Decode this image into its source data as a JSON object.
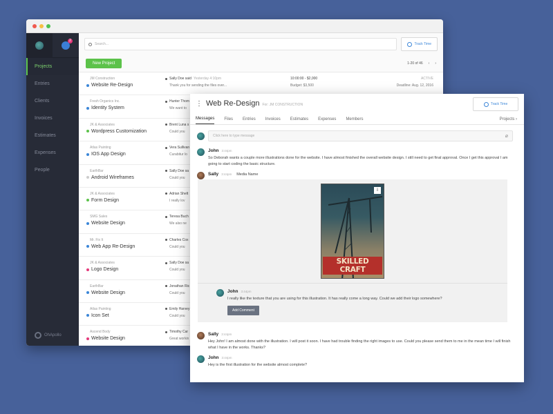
{
  "back_window": {
    "sidebar": {
      "notification_count": "2",
      "items": [
        {
          "label": "Projects",
          "active": true
        },
        {
          "label": "Entries"
        },
        {
          "label": "Clients"
        },
        {
          "label": "Invoices"
        },
        {
          "label": "Estimates"
        },
        {
          "label": "Expenses"
        },
        {
          "label": "People"
        }
      ],
      "footer": "OhApollo"
    },
    "search": {
      "placeholder": "Search..."
    },
    "track_time_label": "Track Time",
    "new_project_label": "New Project",
    "pagination": "1-20 of 46",
    "rows": [
      {
        "client": "JM Construction",
        "project": "Website Re-Design",
        "dot": "#3b86d8",
        "author": "Sally Doe said",
        "time": "Yesterday 4:10pm",
        "message": "Thank you for sending the files over...",
        "range": "10:00:00 - $2,000",
        "budget": "Budget: $3,500",
        "status": "ACTIVE",
        "deadline": "Deadline: Aug. 12, 2016"
      },
      {
        "client": "Fresh Organics Inc.",
        "project": "Identity System",
        "dot": "#3b86d8",
        "author": "Hunter Thom",
        "time": "",
        "message": "We want to",
        "range": "",
        "budget": "",
        "status": "",
        "deadline": ""
      },
      {
        "client": "JK & Associates",
        "project": "Wordpress Customization",
        "dot": "#5cc24a",
        "author": "Brent Luna s",
        "time": "",
        "message": "Could you",
        "range": "",
        "budget": "",
        "status": "",
        "deadline": ""
      },
      {
        "client": "Atlas Painting",
        "project": "IOS App Design",
        "dot": "#3b86d8",
        "author": "Vera Sullivan",
        "time": "",
        "message": "Curabitur lo",
        "range": "",
        "budget": "",
        "status": "",
        "deadline": ""
      },
      {
        "client": "EarthBar",
        "project": "Android Wireframes",
        "dot": "#cccccc",
        "author": "Sally Doe sa",
        "time": "",
        "message": "Could you",
        "range": "",
        "budget": "",
        "status": "",
        "deadline": ""
      },
      {
        "client": "JK & Associates",
        "project": "Form Design",
        "dot": "#5cc24a",
        "author": "Adrian Shelt",
        "time": "",
        "message": "I really lov",
        "range": "",
        "budget": "",
        "status": "",
        "deadline": ""
      },
      {
        "client": "SMG Sales",
        "project": "Website Design",
        "dot": "#3b86d8",
        "author": "Teresa Buch",
        "time": "",
        "message": "We also ne",
        "range": "",
        "budget": "",
        "status": "",
        "deadline": ""
      },
      {
        "client": "Mr. Fix It",
        "project": "Web App Re-Design",
        "dot": "#3b86d8",
        "author": "Charles Cox",
        "time": "",
        "message": "Could you",
        "range": "",
        "budget": "",
        "status": "",
        "deadline": ""
      },
      {
        "client": "JK & Associates",
        "project": "Logo Design",
        "dot": "#e4397a",
        "author": "Sally Doe sa",
        "time": "",
        "message": "Could you",
        "range": "",
        "budget": "",
        "status": "",
        "deadline": ""
      },
      {
        "client": "EarthBar",
        "project": "Website Design",
        "dot": "#3b86d8",
        "author": "Jonathan Ric",
        "time": "",
        "message": "Could you",
        "range": "",
        "budget": "",
        "status": "",
        "deadline": ""
      },
      {
        "client": "Atlas Painting",
        "project": "Icon Set",
        "dot": "#3b86d8",
        "author": "Emily Harvey",
        "time": "",
        "message": "Could you",
        "range": "",
        "budget": "",
        "status": "",
        "deadline": ""
      },
      {
        "client": "Ascend Body",
        "project": "Website Design",
        "dot": "#e4397a",
        "author": "Timothy Car",
        "time": "",
        "message": "Great workin",
        "range": "",
        "budget": "",
        "status": "",
        "deadline": ""
      }
    ]
  },
  "front_window": {
    "title": "Web Re-Design",
    "for_label": "For: JM CONSTRUCTION",
    "track_time_label": "Track Time",
    "tabs": [
      "Messages",
      "Files",
      "Entries",
      "Invoices",
      "Estimates",
      "Expenses",
      "Members"
    ],
    "projects_link": "Projects",
    "compose_placeholder": "Click here to type message",
    "messages": [
      {
        "author": "John",
        "time": "3:44pm",
        "text": "So Deborah wants a couple more illustrations done for the website. I have almost finished the overall website design. I still need to get final approval. Once I get this approval I am going to start coding the basic structure."
      },
      {
        "author": "Sally",
        "time": "3:44pm",
        "media_label": "Media Name",
        "image_caption": "SKILLED CRAFT"
      },
      {
        "author": "John",
        "time": "3:44pm",
        "text": "I really like the texture that you are using for this illustration. It has really come a long way. Could we add their logo somewhere?",
        "button": "Add Comment"
      },
      {
        "author": "Sally",
        "time": "3:44pm",
        "text": "Hey John! I am almost done with the illustration. I will post it soon. I have had trouble finding the right images to use. Could you please send them to me in the mean time I will finish what I have in the works. Thanks?"
      },
      {
        "author": "John",
        "time": "3:44pm",
        "text": "Hey is the first illustration for the website almost complete?"
      }
    ]
  }
}
